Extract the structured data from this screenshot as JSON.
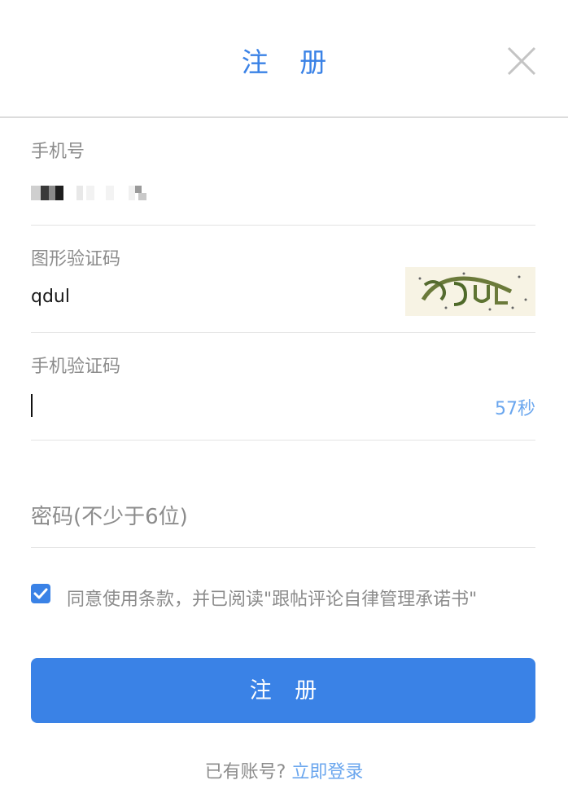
{
  "dialog": {
    "title": "注 册",
    "close_icon": "close-icon"
  },
  "phone": {
    "label": "手机号",
    "value_masked": "pixelated-phone-number"
  },
  "captcha": {
    "label": "图形验证码",
    "value": "qdul",
    "image_icon": "captcha-image"
  },
  "sms_code": {
    "label": "手机验证码",
    "value": "",
    "countdown": "57秒"
  },
  "password": {
    "placeholder": "密码(不少于6位)"
  },
  "agreement": {
    "checked": true,
    "text": "同意使用条款，并已阅读\"跟帖评论自律管理承诺书\""
  },
  "submit": {
    "label": "注 册"
  },
  "footer": {
    "prompt": "已有账号?",
    "login_link": "立即登录"
  },
  "colors": {
    "accent": "#3a82e6",
    "link": "#6aa6ee",
    "muted_text": "#8c8c8c",
    "divider": "#e3e3e3"
  }
}
